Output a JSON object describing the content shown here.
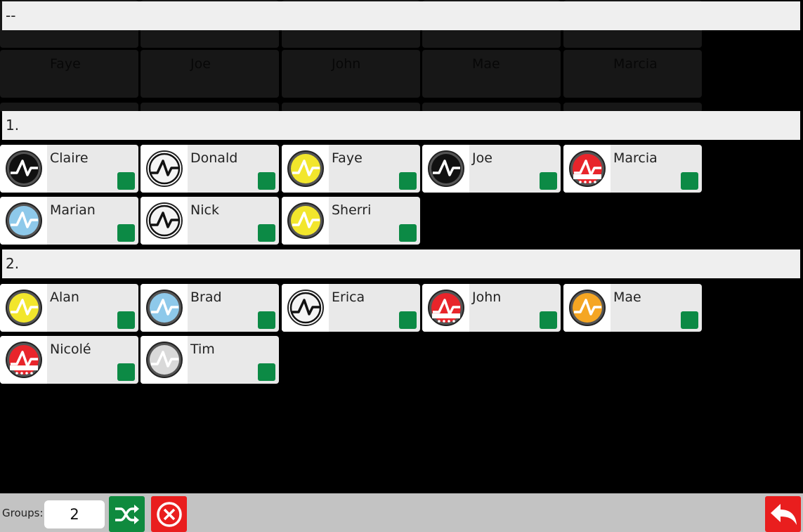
{
  "ghost_header": "--",
  "ghost_names": [
    "Faye",
    "Joe",
    "John",
    "Mae",
    "Marcia"
  ],
  "groups": [
    {
      "title": "1.",
      "members": [
        {
          "name": "Claire",
          "badge": "black"
        },
        {
          "name": "Donald",
          "badge": "white"
        },
        {
          "name": "Faye",
          "badge": "yellow"
        },
        {
          "name": "Joe",
          "badge": "black"
        },
        {
          "name": "Marcia",
          "badge": "hall-of-fame"
        },
        {
          "name": "Marian",
          "badge": "blue"
        },
        {
          "name": "Nick",
          "badge": "white"
        },
        {
          "name": "Sherri",
          "badge": "yellow"
        }
      ]
    },
    {
      "title": "2.",
      "members": [
        {
          "name": "Alan",
          "badge": "yellow"
        },
        {
          "name": "Brad",
          "badge": "blue"
        },
        {
          "name": "Erica",
          "badge": "white"
        },
        {
          "name": "John",
          "badge": "hall-of-fame"
        },
        {
          "name": "Mae",
          "badge": "orange"
        },
        {
          "name": "Nicolé",
          "badge": "hall-of-fame"
        },
        {
          "name": "Tim",
          "badge": "silver"
        }
      ]
    }
  ],
  "footer": {
    "groups_label": "Groups:",
    "groups_value": "2",
    "shuffle_icon": "shuffle-icon",
    "cancel_icon": "close-circle-icon",
    "back_icon": "reply-arrow-icon"
  },
  "badge_colors": {
    "black": "#111111",
    "white": "#f4f4f4",
    "yellow": "#f2e62c",
    "blue": "#8ec9ea",
    "orange": "#f5a623",
    "silver": "#d9d9d9",
    "hall-of-fame": "#e8252b"
  }
}
